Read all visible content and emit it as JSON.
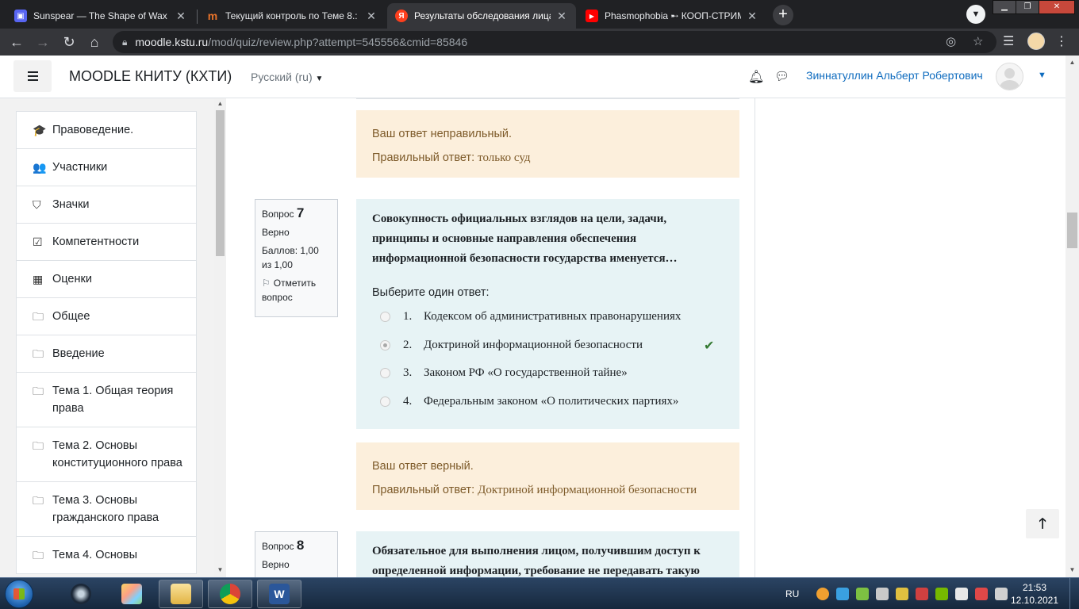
{
  "browser": {
    "tabs": [
      {
        "title": "Sunspear — The Shape of Wax",
        "favicon_color": "#5865f2",
        "favicon_glyph": "▣",
        "active": false
      },
      {
        "title": "Текущий контроль по Теме 8.: п",
        "favicon_color": "#e8732a",
        "favicon_glyph": "m",
        "active": false
      },
      {
        "title": "Результаты обследования лица,",
        "favicon_color": "#fc3f1d",
        "favicon_glyph": "Я",
        "active": true
      },
      {
        "title": "Phasmophobia ➸ КООП-СТРИМ",
        "favicon_color": "#ff0000",
        "favicon_glyph": "▶",
        "active": false
      }
    ],
    "url_host": "moodle.kstu.ru",
    "url_path": "/mod/quiz/review.php?attempt=545556&cmid=85846"
  },
  "navbar": {
    "site_name": "MOODLE КНИТУ (КХТИ)",
    "language": "Русский (ru)",
    "user_name": "Зиннатуллин Альберт Робертович"
  },
  "drawer": {
    "items": [
      {
        "icon": "graduation-cap-icon",
        "glyph": "🎓",
        "label": "Правоведение."
      },
      {
        "icon": "users-icon",
        "glyph": "👥",
        "label": "Участники"
      },
      {
        "icon": "shield-icon",
        "glyph": "⛉",
        "label": "Значки"
      },
      {
        "icon": "checkbox-icon",
        "glyph": "☑",
        "label": "Компетентности"
      },
      {
        "icon": "table-icon",
        "glyph": "▦",
        "label": "Оценки"
      },
      {
        "icon": "folder-icon",
        "glyph": "🗀",
        "label": "Общее"
      },
      {
        "icon": "folder-icon",
        "glyph": "🗀",
        "label": "Введение"
      },
      {
        "icon": "folder-icon",
        "glyph": "🗀",
        "label": "Тема 1. Общая теория права"
      },
      {
        "icon": "folder-icon",
        "glyph": "🗀",
        "label": "Тема 2. Основы конституционного права"
      },
      {
        "icon": "folder-icon",
        "glyph": "🗀",
        "label": "Тема 3. Основы гражданского права"
      },
      {
        "icon": "folder-icon",
        "glyph": "🗀",
        "label": "Тема 4. Основы"
      }
    ]
  },
  "feedback_prev": {
    "line1": "Ваш ответ неправильный.",
    "line2_prefix": "Правильный ответ: ",
    "line2_answer": "только суд"
  },
  "q7": {
    "label": "Вопрос",
    "number": "7",
    "state": "Верно",
    "grade": "Баллов: 1,00 из 1,00",
    "flag": "Отметить вопрос",
    "text": "Совокупность официальных взглядов на цели, задачи, принципы и основные направления обеспечения информационной безопасности государства именуется…",
    "prompt": "Выберите один ответ:",
    "options": [
      {
        "num": "1.",
        "text": "Кодексом об административных правонарушениях"
      },
      {
        "num": "2.",
        "text": "Доктриной информационной безопасности"
      },
      {
        "num": "3.",
        "text": "Законом РФ «О государственной тайне»"
      },
      {
        "num": "4.",
        "text": "Федеральным законом «О политических партиях»"
      }
    ],
    "selected_index": 1,
    "check_glyph": "✔",
    "feedback_line1": "Ваш ответ верный.",
    "feedback_prefix": "Правильный ответ: ",
    "feedback_answer": "Доктриной информационной безопасности"
  },
  "q8": {
    "label": "Вопрос",
    "number": "8",
    "state": "Верно",
    "text": "Обязательное для выполнения лицом, получившим доступ к определенной информации, требование не передавать такую"
  },
  "taskbar": {
    "lang": "RU",
    "time": "21:53",
    "date": "12.10.2021"
  }
}
